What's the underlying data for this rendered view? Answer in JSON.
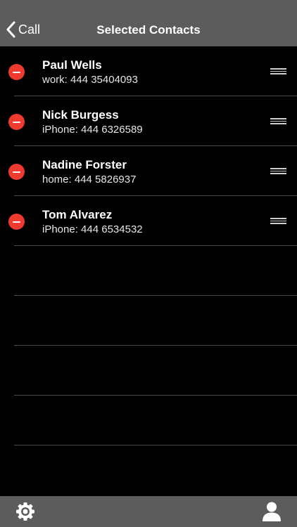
{
  "navbar": {
    "back_label": "Call",
    "title": "Selected Contacts"
  },
  "contacts": [
    {
      "name": "Paul Wells",
      "detail": "work: 444 35404093"
    },
    {
      "name": "Nick Burgess",
      "detail": "iPhone: 444 6326589"
    },
    {
      "name": "Nadine Forster",
      "detail": "home: 444 5826937"
    },
    {
      "name": "Tom Alvarez",
      "detail": "iPhone: 444 6534532"
    }
  ],
  "icons": {
    "back": "chevron-left-icon",
    "delete": "minus-circle-icon",
    "reorder": "drag-handle-icon",
    "settings": "gear-icon",
    "profile": "person-icon"
  },
  "colors": {
    "navbar_bg": "#5c5c5c",
    "background": "#000000",
    "delete_red": "#ef3b2f"
  }
}
